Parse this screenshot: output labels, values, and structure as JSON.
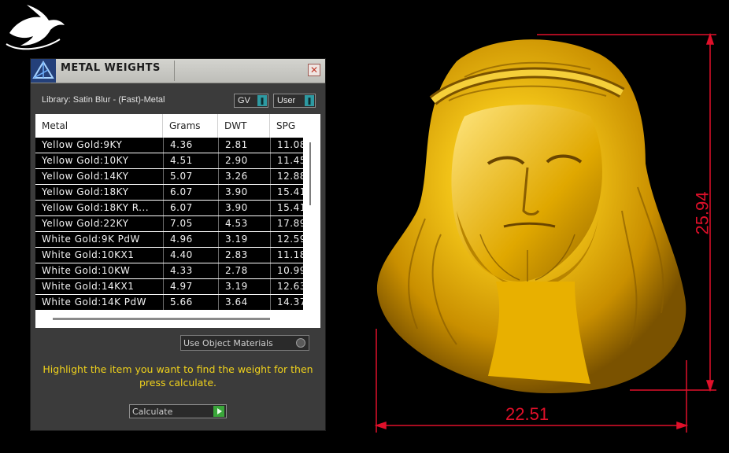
{
  "panel": {
    "title": "METAL WEIGHTS",
    "close_glyph": "✕",
    "library_label": "Library: Satin Blur - (Fast)-Metal",
    "gv_select": "GV",
    "user_select": "User",
    "columns": [
      "Metal",
      "Grams",
      "DWT",
      "SPG"
    ],
    "rows": [
      {
        "metal": "Yellow Gold:9KY",
        "grams": "4.36",
        "dwt": "2.81",
        "spg": "11.08"
      },
      {
        "metal": "Yellow Gold:10KY",
        "grams": "4.51",
        "dwt": "2.90",
        "spg": "11.45"
      },
      {
        "metal": "Yellow Gold:14KY",
        "grams": "5.07",
        "dwt": "3.26",
        "spg": "12.88"
      },
      {
        "metal": "Yellow Gold:18KY",
        "grams": "6.07",
        "dwt": "3.90",
        "spg": "15.41"
      },
      {
        "metal": "Yellow Gold:18KY R...",
        "grams": "6.07",
        "dwt": "3.90",
        "spg": "15.41"
      },
      {
        "metal": "Yellow Gold:22KY",
        "grams": "7.05",
        "dwt": "4.53",
        "spg": "17.89"
      },
      {
        "metal": "White Gold:9K PdW",
        "grams": "4.96",
        "dwt": "3.19",
        "spg": "12.59"
      },
      {
        "metal": "White Gold:10KX1",
        "grams": "4.40",
        "dwt": "2.83",
        "spg": "11.18"
      },
      {
        "metal": "White Gold:10KW",
        "grams": "4.33",
        "dwt": "2.78",
        "spg": "10.99"
      },
      {
        "metal": "White Gold:14KX1",
        "grams": "4.97",
        "dwt": "3.19",
        "spg": "12.63"
      },
      {
        "metal": "White Gold:14K PdW",
        "grams": "5.66",
        "dwt": "3.64",
        "spg": "14.37"
      }
    ],
    "use_object_materials": "Use Object Materials",
    "instructions": "Highlight the item you want to find the weight for then press calculate.",
    "calculate_label": "Calculate"
  },
  "render": {
    "width_dimension": "22.51",
    "height_dimension": "25.94"
  },
  "colors": {
    "panel_bg": "#3b3b3b",
    "instruction_text": "#f0d21c",
    "dimension_lines": "#e0102a",
    "gold": "#e6b400"
  },
  "icons": {
    "logo": "white-dove-logo-icon",
    "app": "triangle-app-icon",
    "close": "close-icon",
    "dropdown": "dropdown-arrow-icon",
    "calculate": "play-icon"
  }
}
